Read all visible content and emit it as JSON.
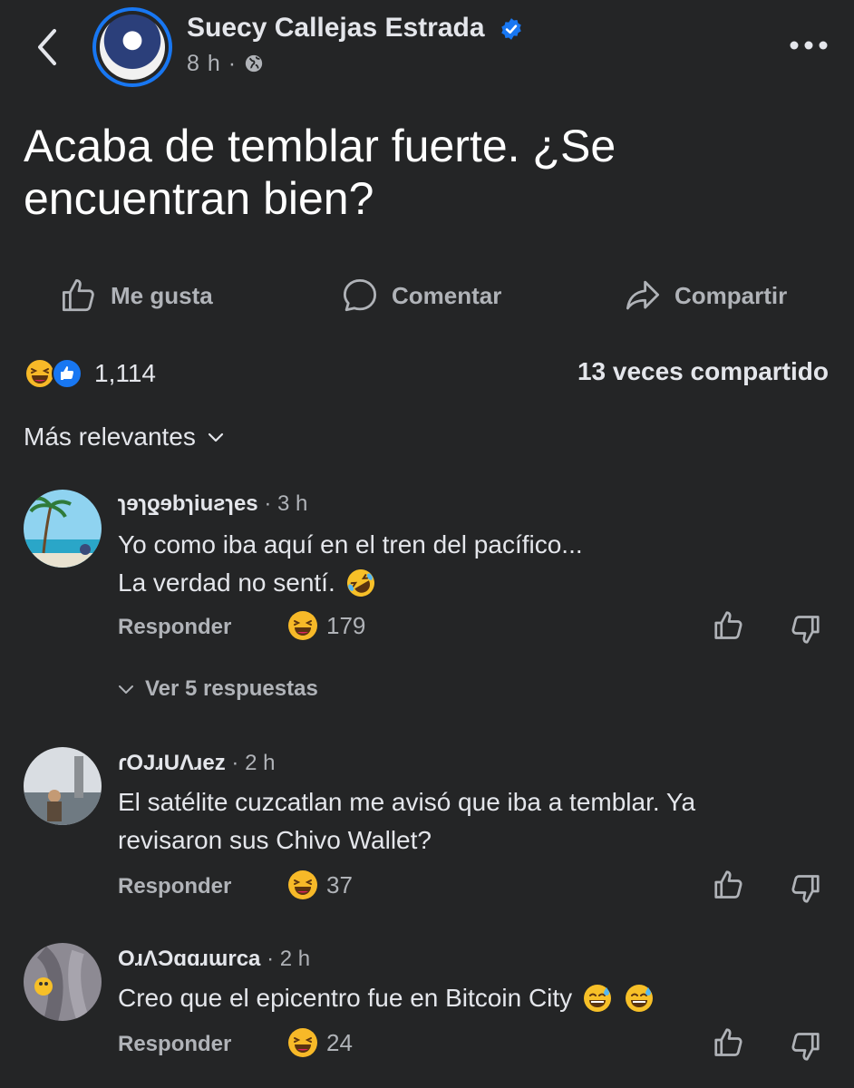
{
  "post": {
    "author": "Suecy Callejas Estrada",
    "time": "8 h",
    "separator": "·",
    "text": "Acaba de temblar fuerte. ¿Se encuentran bien?"
  },
  "actions": {
    "like": "Me gusta",
    "comment": "Comentar",
    "share": "Compartir"
  },
  "stats": {
    "reactions": "1,114",
    "shares": "13 veces compartido"
  },
  "sort": {
    "label": "Más relevantes"
  },
  "comments": [
    {
      "name": "ɿɘɿƍɘbɿiuƨɿes",
      "time": "· 3 h",
      "text_line1": "Yo como iba aquí en el tren del pacífico...",
      "text_line2": "La verdad no sentí.",
      "reply": "Responder",
      "reactions": "179",
      "view_replies": "Ver 5 respuestas"
    },
    {
      "name": "ɾOJɹUɅɹez",
      "time": "· 2 h",
      "text": "El satélite cuzcatlan me avisó que iba a temblar. Ya revisaron sus Chivo Wallet?",
      "reply": "Responder",
      "reactions": "37"
    },
    {
      "name": "OɹɅƆɑɑɹɯrca",
      "time": "· 2 h",
      "text": "Creo que el epicentro fue en Bitcoin City",
      "reply": "Responder",
      "reactions": "24"
    }
  ],
  "colors": {
    "background": "#242526",
    "text": "#e4e6eb",
    "muted": "#b0b3b8",
    "accent": "#1877f2"
  }
}
